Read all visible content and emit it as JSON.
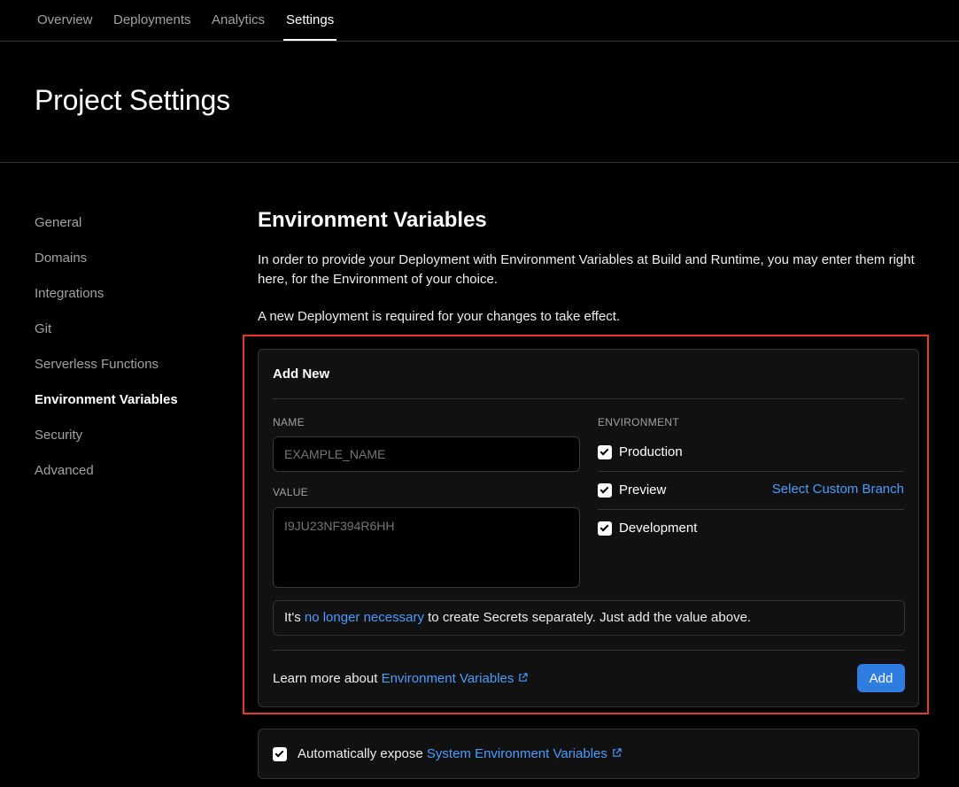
{
  "nav": {
    "tabs": [
      {
        "label": "Overview"
      },
      {
        "label": "Deployments"
      },
      {
        "label": "Analytics"
      },
      {
        "label": "Settings",
        "active": true
      }
    ]
  },
  "header": {
    "title": "Project Settings"
  },
  "sidebar": {
    "items": [
      {
        "label": "General"
      },
      {
        "label": "Domains"
      },
      {
        "label": "Integrations"
      },
      {
        "label": "Git"
      },
      {
        "label": "Serverless Functions"
      },
      {
        "label": "Environment Variables",
        "active": true
      },
      {
        "label": "Security"
      },
      {
        "label": "Advanced"
      }
    ]
  },
  "main": {
    "title": "Environment Variables",
    "description": "In order to provide your Deployment with Environment Variables at Build and Runtime, you may enter them right here, for the Environment of your choice.",
    "note": "A new Deployment is required for your changes to take effect.",
    "add_new": {
      "title": "Add New",
      "name_label": "NAME",
      "name_placeholder": "EXAMPLE_NAME",
      "value_label": "VALUE",
      "value_placeholder": "I9JU23NF394R6HH",
      "environment_label": "ENVIRONMENT",
      "environments": [
        {
          "label": "Production",
          "checked": true
        },
        {
          "label": "Preview",
          "checked": true
        },
        {
          "label": "Development",
          "checked": true
        }
      ],
      "custom_branch_link": "Select Custom Branch",
      "info_prefix": "It's ",
      "info_link": "no longer necessary",
      "info_suffix": " to create Secrets separately. Just add the value above.",
      "learn_prefix": "Learn more about ",
      "learn_link": "Environment Variables",
      "add_button": "Add"
    },
    "system_vars": {
      "checked": true,
      "prefix": "Automatically expose ",
      "link": "System Environment Variables"
    }
  },
  "colors": {
    "background": "#000000",
    "accent": "#4a9cff",
    "button": "#2f7de1",
    "highlight": "#e5382f"
  }
}
